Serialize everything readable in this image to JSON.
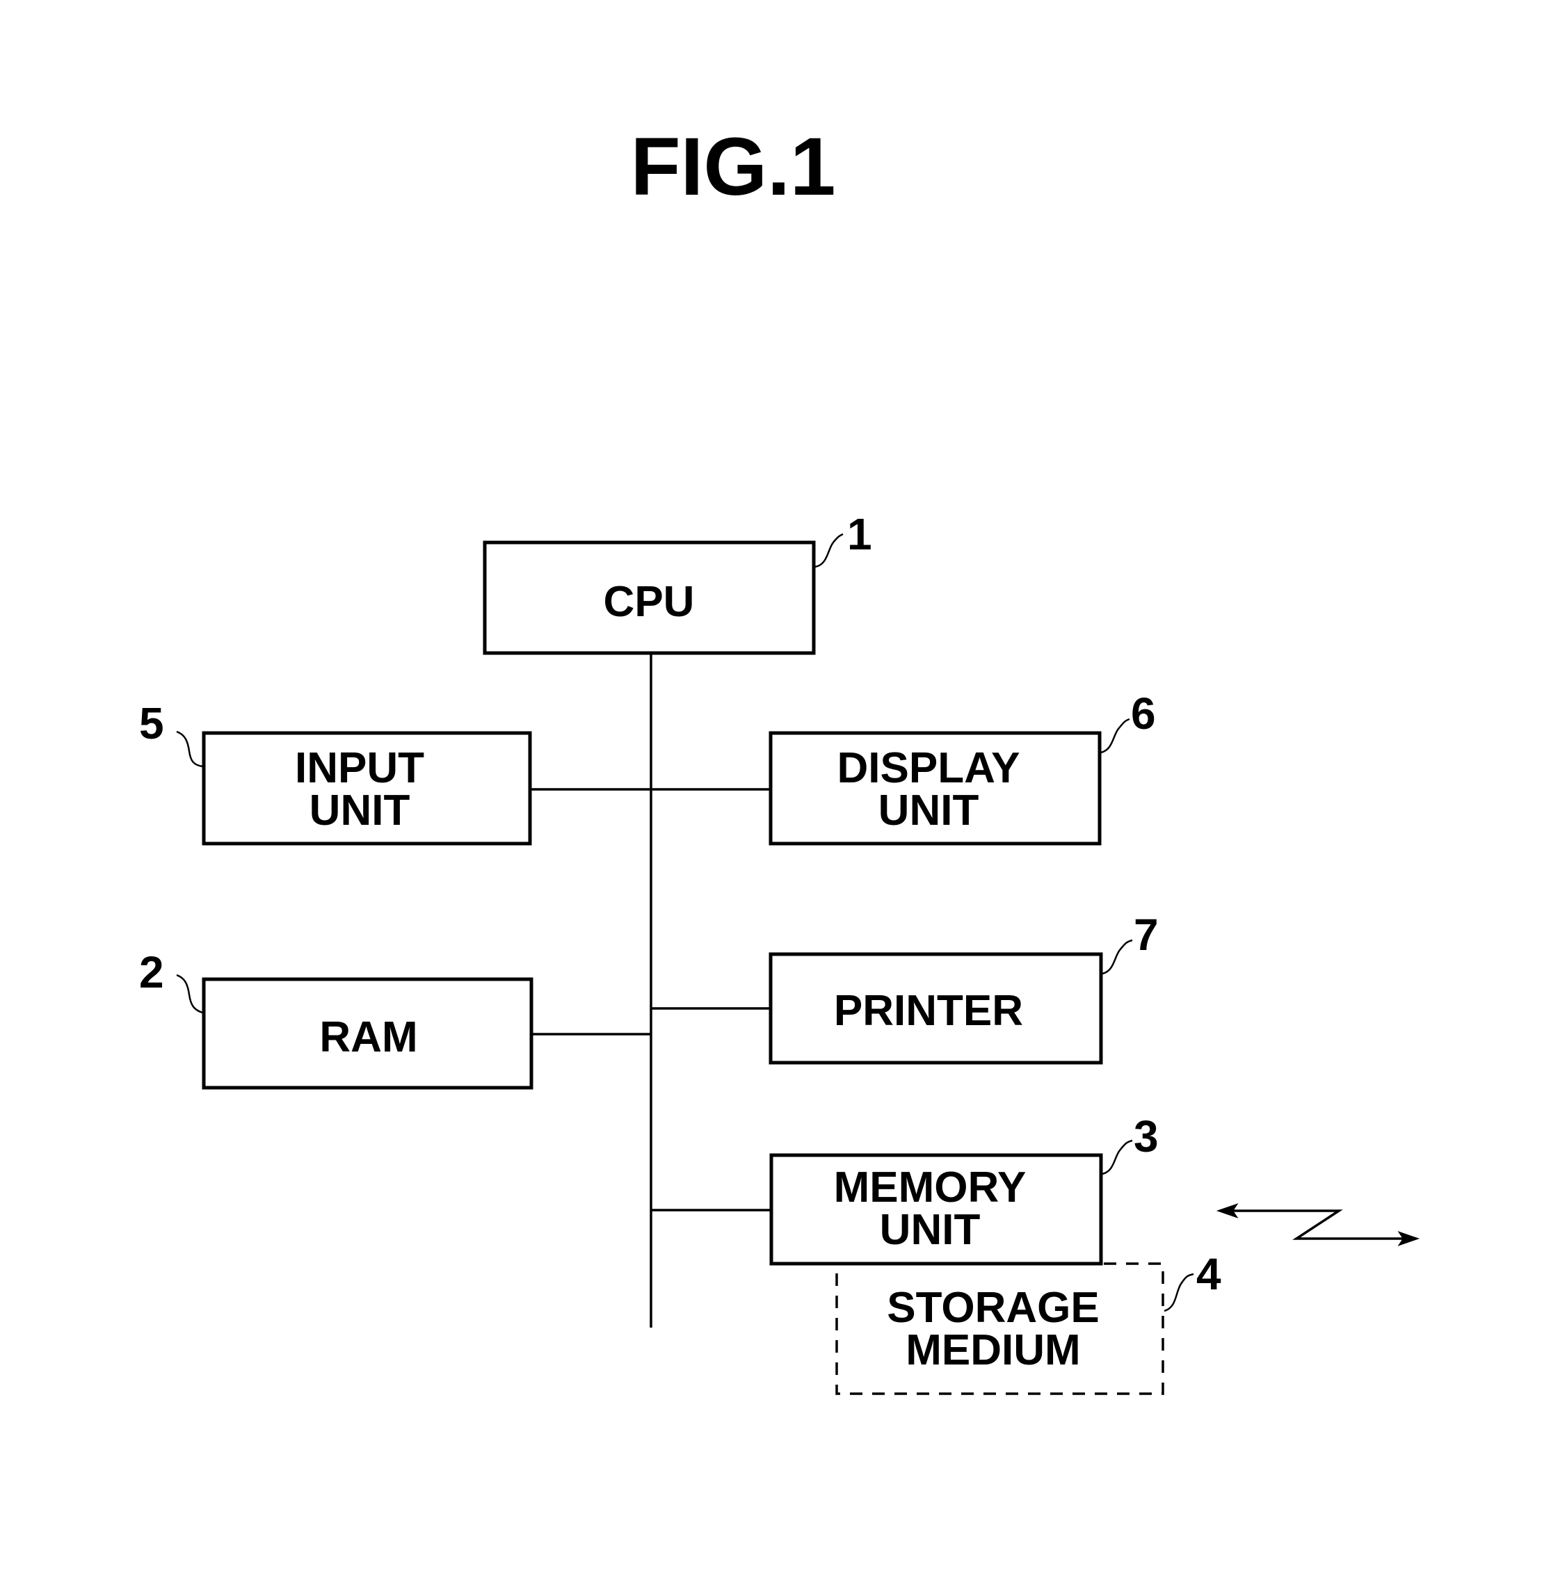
{
  "figure": {
    "title": "FIG.1"
  },
  "blocks": {
    "cpu": {
      "ref": "1",
      "lines": [
        "CPU"
      ]
    },
    "input_unit": {
      "ref": "5",
      "lines": [
        "INPUT",
        "UNIT"
      ]
    },
    "display_unit": {
      "ref": "6",
      "lines": [
        "DISPLAY",
        "UNIT"
      ]
    },
    "ram": {
      "ref": "2",
      "lines": [
        "RAM"
      ]
    },
    "printer": {
      "ref": "7",
      "lines": [
        "PRINTER"
      ]
    },
    "memory_unit": {
      "ref": "3",
      "lines": [
        "MEMORY",
        "UNIT"
      ]
    },
    "storage_medium": {
      "ref": "4",
      "lines": [
        "STORAGE",
        "MEDIUM"
      ],
      "style": "dashed"
    }
  },
  "connections": [
    "cpu-bus",
    "input_unit-bus",
    "display_unit-bus",
    "ram-bus",
    "printer-bus",
    "memory_unit-bus"
  ],
  "communication_symbol": "bidirectional-wireless-arrow"
}
